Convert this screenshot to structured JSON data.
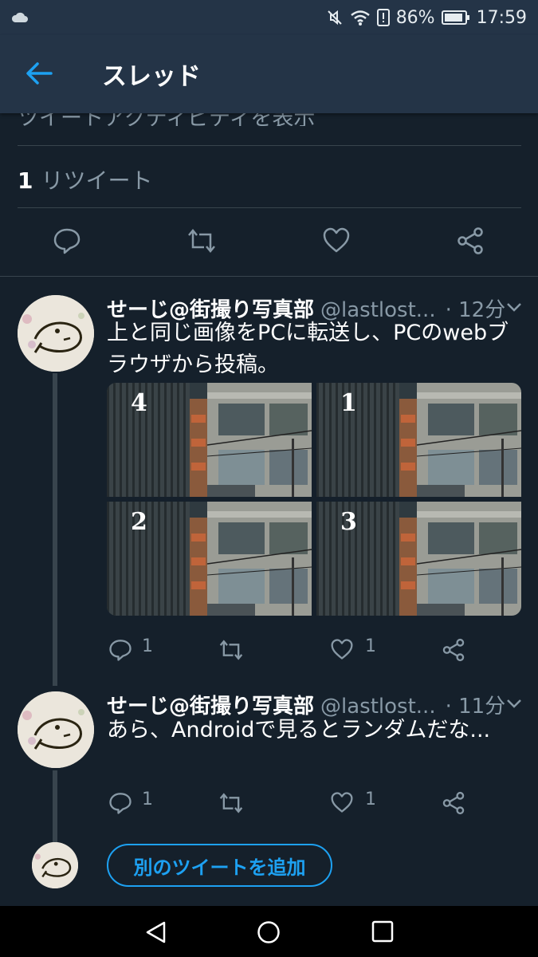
{
  "status_bar": {
    "battery": "86%",
    "time": "17:59",
    "icons": [
      "cloud-icon",
      "mute-icon",
      "wifi-icon",
      "sim-alert-icon",
      "battery-icon"
    ]
  },
  "header": {
    "title": "スレッド",
    "back_icon": "back-arrow-icon"
  },
  "main_tweet": {
    "activity_partial": "ツイートアクティビティを表示",
    "retweet_count": "1",
    "retweet_label": "リツイート"
  },
  "replies": [
    {
      "name": "せーじ@街撮り写真部",
      "handle": "@lastlost...",
      "time": "· 12分",
      "text": "上と同じ画像をPCに転送し、PCのwebブラウザから投稿。",
      "media_labels": [
        "4",
        "1",
        "2",
        "3"
      ],
      "reply_count": "1",
      "like_count": "1"
    },
    {
      "name": "せーじ@街撮り写真部",
      "handle": "@lastlost...",
      "time": "· 11分",
      "text": "あら、Androidで見るとランダムだな...",
      "reply_count": "1",
      "like_count": "1"
    }
  ],
  "add_tweet_label": "別のツイートを追加",
  "colors": {
    "background": "#15202b",
    "header": "#243447",
    "accent": "#1da1f2",
    "muted": "#8899a6",
    "divider": "#38444d"
  }
}
